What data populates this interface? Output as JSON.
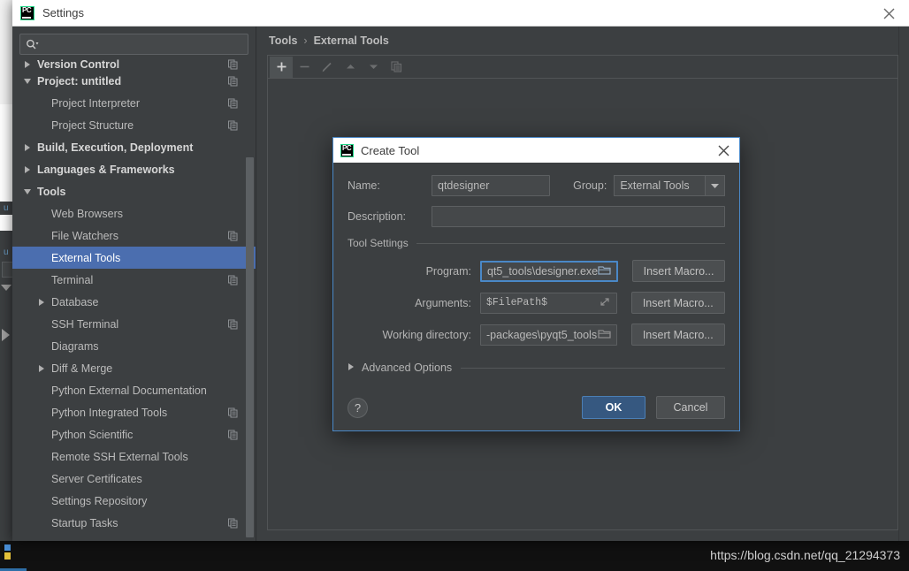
{
  "window": {
    "title": "Settings",
    "close_label": "✕",
    "app_icon": "pycharm-pc-icon"
  },
  "search": {
    "placeholder": "",
    "value": "",
    "icon": "search-icon"
  },
  "sidebar": {
    "scroll_hint": "scrollbar",
    "items": [
      {
        "label": "Version Control",
        "level": 1,
        "bold": true,
        "twisty": "right",
        "badge": true,
        "selected": false,
        "partial": true
      },
      {
        "label": "Project: untitled",
        "level": 1,
        "bold": true,
        "twisty": "down",
        "badge": true,
        "selected": false
      },
      {
        "label": "Project Interpreter",
        "level": 2,
        "bold": false,
        "twisty": "none",
        "badge": true,
        "selected": false
      },
      {
        "label": "Project Structure",
        "level": 2,
        "bold": false,
        "twisty": "none",
        "badge": true,
        "selected": false
      },
      {
        "label": "Build, Execution, Deployment",
        "level": 1,
        "bold": true,
        "twisty": "right",
        "badge": false,
        "selected": false
      },
      {
        "label": "Languages & Frameworks",
        "level": 1,
        "bold": true,
        "twisty": "right",
        "badge": false,
        "selected": false
      },
      {
        "label": "Tools",
        "level": 1,
        "bold": true,
        "twisty": "down",
        "badge": false,
        "selected": false
      },
      {
        "label": "Web Browsers",
        "level": 2,
        "bold": false,
        "twisty": "none",
        "badge": false,
        "selected": false
      },
      {
        "label": "File Watchers",
        "level": 2,
        "bold": false,
        "twisty": "none",
        "badge": true,
        "selected": false
      },
      {
        "label": "External Tools",
        "level": 2,
        "bold": false,
        "twisty": "none",
        "badge": false,
        "selected": true
      },
      {
        "label": "Terminal",
        "level": 2,
        "bold": false,
        "twisty": "none",
        "badge": true,
        "selected": false
      },
      {
        "label": "Database",
        "level": 2,
        "bold": false,
        "twisty": "right",
        "badge": false,
        "selected": false
      },
      {
        "label": "SSH Terminal",
        "level": 2,
        "bold": false,
        "twisty": "none",
        "badge": true,
        "selected": false
      },
      {
        "label": "Diagrams",
        "level": 2,
        "bold": false,
        "twisty": "none",
        "badge": false,
        "selected": false
      },
      {
        "label": "Diff & Merge",
        "level": 2,
        "bold": false,
        "twisty": "right",
        "badge": false,
        "selected": false
      },
      {
        "label": "Python External Documentation",
        "level": 2,
        "bold": false,
        "twisty": "none",
        "badge": false,
        "selected": false
      },
      {
        "label": "Python Integrated Tools",
        "level": 2,
        "bold": false,
        "twisty": "none",
        "badge": true,
        "selected": false
      },
      {
        "label": "Python Scientific",
        "level": 2,
        "bold": false,
        "twisty": "none",
        "badge": true,
        "selected": false
      },
      {
        "label": "Remote SSH External Tools",
        "level": 2,
        "bold": false,
        "twisty": "none",
        "badge": false,
        "selected": false
      },
      {
        "label": "Server Certificates",
        "level": 2,
        "bold": false,
        "twisty": "none",
        "badge": false,
        "selected": false
      },
      {
        "label": "Settings Repository",
        "level": 2,
        "bold": false,
        "twisty": "none",
        "badge": false,
        "selected": false
      },
      {
        "label": "Startup Tasks",
        "level": 2,
        "bold": false,
        "twisty": "none",
        "badge": true,
        "selected": false
      }
    ]
  },
  "breadcrumb": {
    "parent": "Tools",
    "separator": "›",
    "current": "External Tools"
  },
  "toolbar": {
    "buttons": [
      {
        "name": "add-button",
        "icon": "plus-icon",
        "enabled": true
      },
      {
        "name": "remove-button",
        "icon": "minus-icon",
        "enabled": false
      },
      {
        "name": "edit-button",
        "icon": "pencil-icon",
        "enabled": false
      },
      {
        "name": "move-up-button",
        "icon": "arrow-up-icon",
        "enabled": false
      },
      {
        "name": "move-down-button",
        "icon": "arrow-down-icon",
        "enabled": false
      },
      {
        "name": "copy-button",
        "icon": "copy-icon",
        "enabled": false
      }
    ]
  },
  "dialog": {
    "title": "Create Tool",
    "close_label": "✕",
    "name_label": "Name:",
    "name_value": "qtdesigner",
    "group_label": "Group:",
    "group_value": "External Tools",
    "description_label": "Description:",
    "description_value": "",
    "section_title": "Tool Settings",
    "program_label": "Program:",
    "program_value": "qt5_tools\\designer.exe",
    "arguments_label": "Arguments:",
    "arguments_value": "$FilePath$",
    "working_dir_label": "Working directory:",
    "working_dir_value": "-packages\\pyqt5_tools",
    "insert_macro_label": "Insert Macro...",
    "advanced_options_label": "Advanced Options",
    "help_label": "?",
    "ok_label": "OK",
    "cancel_label": "Cancel"
  },
  "watermark": {
    "text": "https://blog.csdn.net/qq_21294373"
  },
  "colors": {
    "accent_blue": "#4b6eaf",
    "focus_blue": "#4a88c7",
    "ok_blue": "#365880",
    "panel_bg": "#3c3f41",
    "field_bg": "#45484a",
    "text": "#b4b4b4"
  }
}
